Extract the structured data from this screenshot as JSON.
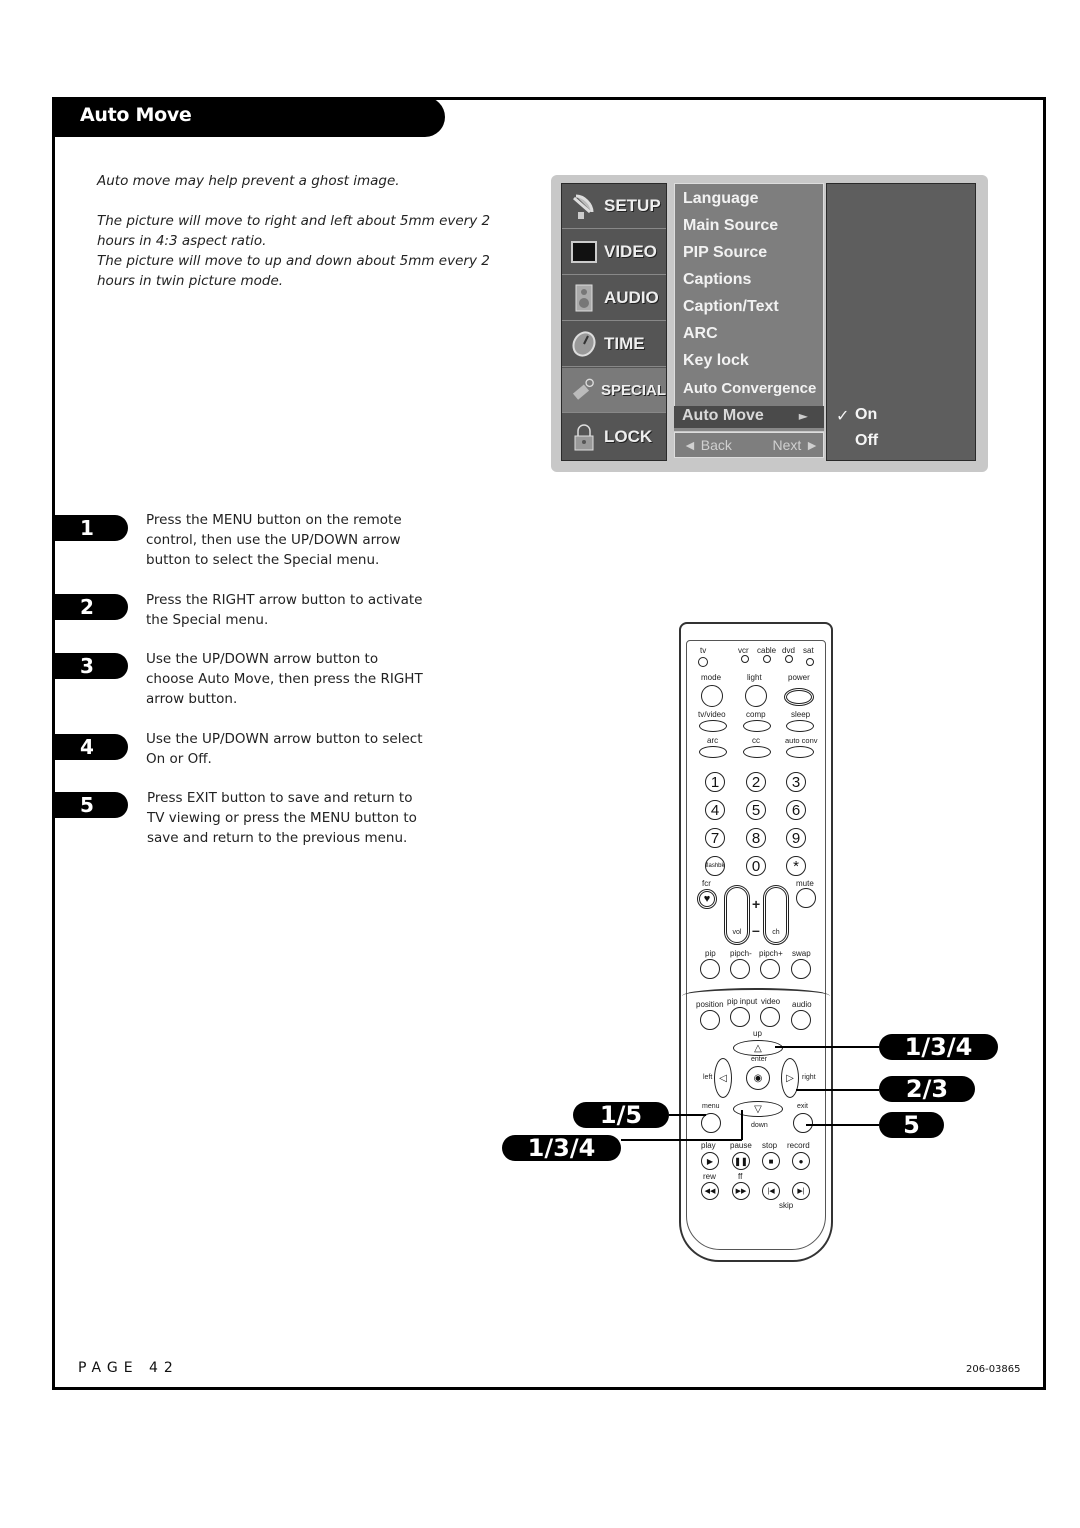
{
  "section": {
    "title": "Auto Move"
  },
  "intro": {
    "line1": "Auto move may help prevent a ghost image.",
    "line2": "The picture will move to right and left about 5mm every 2 hours in 4:3 aspect ratio.",
    "line3": "The picture will move to up and down about 5mm every 2 hours in twin picture mode."
  },
  "osd": {
    "tabs": [
      {
        "label": "SETUP",
        "icon": "satellite-dish-icon"
      },
      {
        "label": "VIDEO",
        "icon": "tv-screen-icon"
      },
      {
        "label": "AUDIO",
        "icon": "speaker-icon"
      },
      {
        "label": "TIME",
        "icon": "clock-icon"
      },
      {
        "label": "SPECIAL",
        "icon": "tag-icon",
        "active": true
      },
      {
        "label": "LOCK",
        "icon": "padlock-icon"
      }
    ],
    "menu_items": [
      "Language",
      "Main Source",
      "PIP Source",
      "Captions",
      "Caption/Text",
      "ARC",
      "Key lock",
      "Auto Convergence"
    ],
    "selected_item": "Auto Move",
    "selected_arrow": "►",
    "back_label": "◄ Back",
    "next_label": "Next ►",
    "options": [
      {
        "label": "On",
        "checked": true,
        "check": "✓"
      },
      {
        "label": "Off",
        "checked": false
      }
    ]
  },
  "steps": [
    {
      "num": "1",
      "text": "Press the MENU button on the remote control, then use the UP/DOWN arrow button to select the Special menu."
    },
    {
      "num": "2",
      "text": "Press the RIGHT arrow button to activate the Special menu."
    },
    {
      "num": "3",
      "text": "Use the UP/DOWN arrow button to choose Auto Move, then press the RIGHT arrow button."
    },
    {
      "num": "4",
      "text": "Use the UP/DOWN arrow button to select On or Off."
    },
    {
      "num": "5",
      "text": "Press EXIT button to save and return to TV viewing or press the MENU button to save and return to the previous menu."
    }
  ],
  "callouts": {
    "up": "1/3/4",
    "right": "2/3",
    "exit": "5",
    "menu": "1/5",
    "down": "1/3/4"
  },
  "remote": {
    "modes": [
      "tv",
      "vcr",
      "cable",
      "dvd",
      "sat"
    ],
    "row1": [
      "mode",
      "light",
      "power"
    ],
    "row2": [
      "tv/video",
      "comp",
      "sleep"
    ],
    "row3": [
      "arc",
      "cc",
      "auto conv"
    ],
    "digits": [
      "1",
      "2",
      "3",
      "4",
      "5",
      "6",
      "7",
      "8",
      "9",
      "flashbk",
      "0",
      "*"
    ],
    "fcr": "fcr",
    "mute": "mute",
    "vol": "vol",
    "ch": "ch",
    "plus": "+",
    "minus": "–",
    "pip_row": [
      "pip",
      "pipch-",
      "pipch+",
      "swap"
    ],
    "input_row": [
      "position",
      "pip input",
      "video",
      "audio"
    ],
    "nav": {
      "up": "up",
      "down": "down",
      "left": "left",
      "right": "right",
      "enter": "enter",
      "menu": "menu",
      "exit": "exit"
    },
    "transport": [
      "play",
      "pause",
      "stop",
      "record"
    ],
    "transport2": [
      "rew",
      "ff"
    ],
    "skip": "skip"
  },
  "footer": {
    "page": "PAGE 42",
    "code": "206-03865"
  }
}
